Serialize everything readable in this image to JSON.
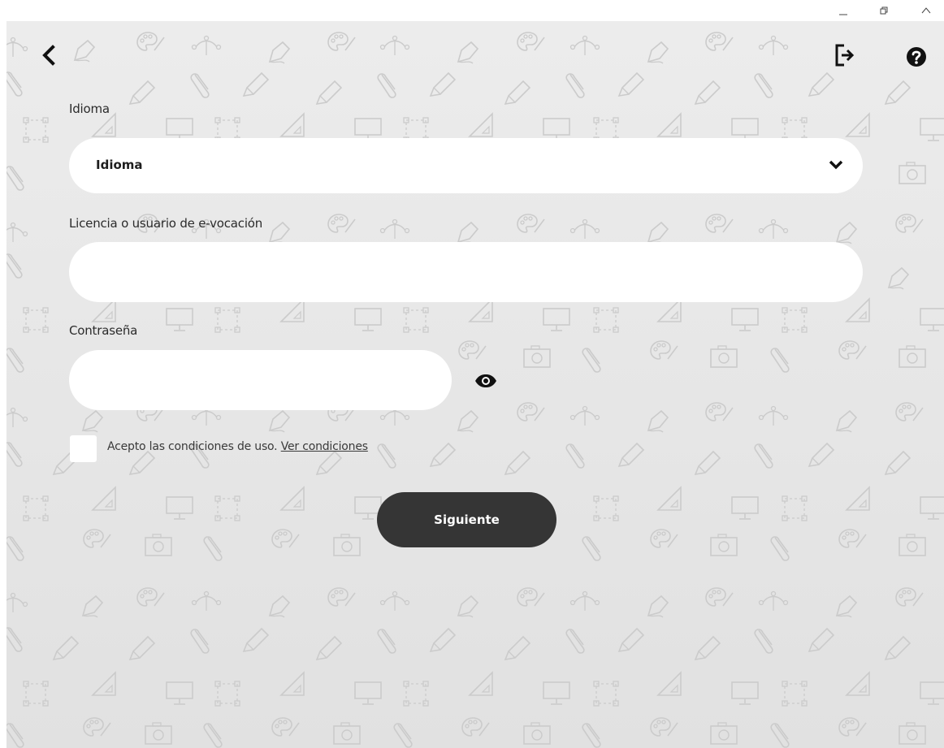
{
  "window": {
    "controls": {
      "minimize_icon": "minimize-icon",
      "restore_icon": "restore-icon",
      "collapse_icon": "chevron-up-icon"
    }
  },
  "header": {
    "back_icon": "chevron-left-icon",
    "logout_icon": "logout-icon",
    "help_icon": "help-icon"
  },
  "form": {
    "language": {
      "label": "Idioma",
      "selected": "Idioma"
    },
    "license": {
      "label": "Licencia o usuario de e-vocación",
      "value": "",
      "placeholder": ""
    },
    "password": {
      "label": "Contraseña",
      "value": "",
      "placeholder": "",
      "toggle_icon": "eye-icon"
    },
    "terms": {
      "text": "Acepto las condiciones de uso.",
      "link": "Ver condiciones",
      "checked": false
    },
    "submit_label": "Siguiente"
  },
  "colors": {
    "background_top": "#ececec",
    "background_bottom": "#e1e1e1",
    "pattern": "#cfcfcf",
    "button": "#353535",
    "field": "#ffffff"
  }
}
